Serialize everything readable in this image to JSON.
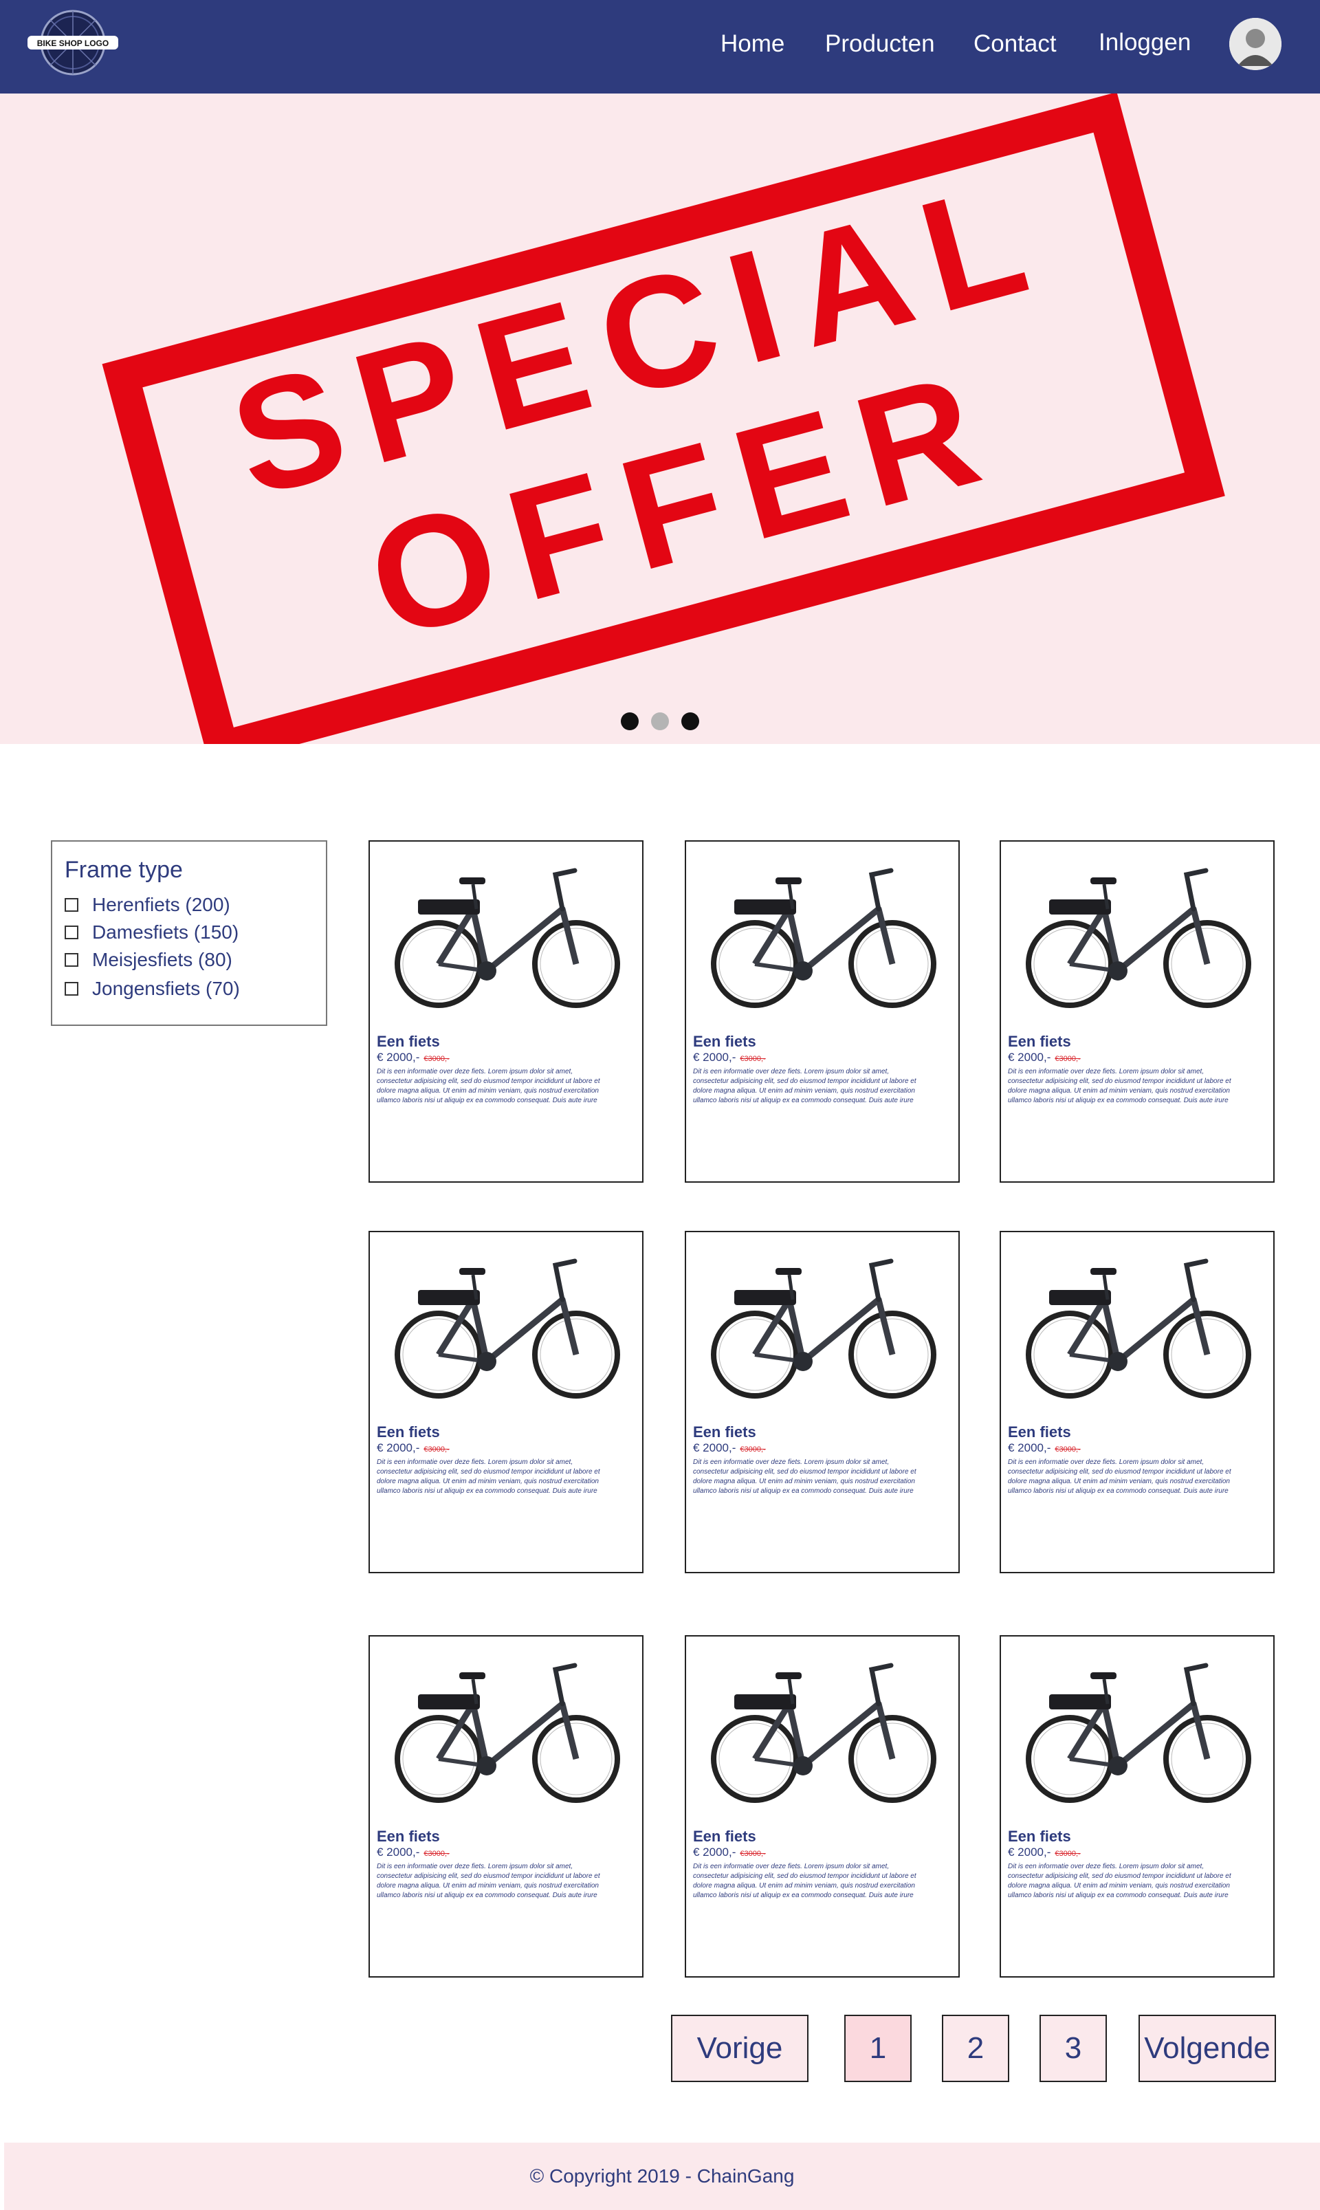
{
  "nav": {
    "logo_text": "BIKE SHOP LOGO",
    "links": [
      "Home",
      "Producten",
      "Contact",
      "Inloggen"
    ]
  },
  "hero": {
    "stamp_line1": "SPECIAL",
    "stamp_line2": "OFFER",
    "stamp_color": "#e30613",
    "slides_total": 3,
    "active_slide": 2
  },
  "filter": {
    "title": "Frame type",
    "options": [
      "Herenfiets (200)",
      "Damesfiets (150)",
      "Meisjesfiets (80)",
      "Jongensfiets (70)"
    ]
  },
  "products": [
    {
      "name": "Een fiets",
      "price": "€ 2000,-",
      "old_price": "€3000,-",
      "desc": "Dit is een informatie over deze fiets. Lorem ipsum dolor sit amet, consectetur adipisicing elit, sed do eiusmod tempor incididunt ut labore et dolore magna aliqua. Ut enim ad minim veniam, quis nostrud exercitation ullamco laboris nisi ut aliquip ex ea commodo consequat. Duis aute irure"
    },
    {
      "name": "Een fiets",
      "price": "€ 2000,-",
      "old_price": "€3000,-",
      "desc": "Dit is een informatie over deze fiets. Lorem ipsum dolor sit amet, consectetur adipisicing elit, sed do eiusmod tempor incididunt ut labore et dolore magna aliqua. Ut enim ad minim veniam, quis nostrud exercitation ullamco laboris nisi ut aliquip ex ea commodo consequat. Duis aute irure"
    },
    {
      "name": "Een fiets",
      "price": "€ 2000,-",
      "old_price": "€3000,-",
      "desc": "Dit is een informatie over deze fiets. Lorem ipsum dolor sit amet, consectetur adipisicing elit, sed do eiusmod tempor incididunt ut labore et dolore magna aliqua. Ut enim ad minim veniam, quis nostrud exercitation ullamco laboris nisi ut aliquip ex ea commodo consequat. Duis aute irure"
    },
    {
      "name": "Een fiets",
      "price": "€ 2000,-",
      "old_price": "€3000,-",
      "desc": "Dit is een informatie over deze fiets. Lorem ipsum dolor sit amet, consectetur adipisicing elit, sed do eiusmod tempor incididunt ut labore et dolore magna aliqua. Ut enim ad minim veniam, quis nostrud exercitation ullamco laboris nisi ut aliquip ex ea commodo consequat. Duis aute irure"
    },
    {
      "name": "Een fiets",
      "price": "€ 2000,-",
      "old_price": "€3000,-",
      "desc": "Dit is een informatie over deze fiets. Lorem ipsum dolor sit amet, consectetur adipisicing elit, sed do eiusmod tempor incididunt ut labore et dolore magna aliqua. Ut enim ad minim veniam, quis nostrud exercitation ullamco laboris nisi ut aliquip ex ea commodo consequat. Duis aute irure"
    },
    {
      "name": "Een fiets",
      "price": "€ 2000,-",
      "old_price": "€3000,-",
      "desc": "Dit is een informatie over deze fiets. Lorem ipsum dolor sit amet, consectetur adipisicing elit, sed do eiusmod tempor incididunt ut labore et dolore magna aliqua. Ut enim ad minim veniam, quis nostrud exercitation ullamco laboris nisi ut aliquip ex ea commodo consequat. Duis aute irure"
    },
    {
      "name": "Een fiets",
      "price": "€ 2000,-",
      "old_price": "€3000,-",
      "desc": "Dit is een informatie over deze fiets. Lorem ipsum dolor sit amet, consectetur adipisicing elit, sed do eiusmod tempor incididunt ut labore et dolore magna aliqua. Ut enim ad minim veniam, quis nostrud exercitation ullamco laboris nisi ut aliquip ex ea commodo consequat. Duis aute irure"
    },
    {
      "name": "Een fiets",
      "price": "€ 2000,-",
      "old_price": "€3000,-",
      "desc": "Dit is een informatie over deze fiets. Lorem ipsum dolor sit amet, consectetur adipisicing elit, sed do eiusmod tempor incididunt ut labore et dolore magna aliqua. Ut enim ad minim veniam, quis nostrud exercitation ullamco laboris nisi ut aliquip ex ea commodo consequat. Duis aute irure"
    },
    {
      "name": "Een fiets",
      "price": "€ 2000,-",
      "old_price": "€3000,-",
      "desc": "Dit is een informatie over deze fiets. Lorem ipsum dolor sit amet, consectetur adipisicing elit, sed do eiusmod tempor incididunt ut labore et dolore magna aliqua. Ut enim ad minim veniam, quis nostrud exercitation ullamco laboris nisi ut aliquip ex ea commodo consequat. Duis aute irure"
    }
  ],
  "pagination": {
    "prev": "Vorige",
    "pages": [
      "1",
      "2",
      "3"
    ],
    "next": "Volgende",
    "current": "1"
  },
  "footer": {
    "copyright": "© Copyright 2019 - ChainGang"
  },
  "colors": {
    "navbar": "#2e3b7d",
    "hero_bg": "#fbe9ec",
    "text": "#2e3b7d",
    "sale": "#d8232a"
  }
}
